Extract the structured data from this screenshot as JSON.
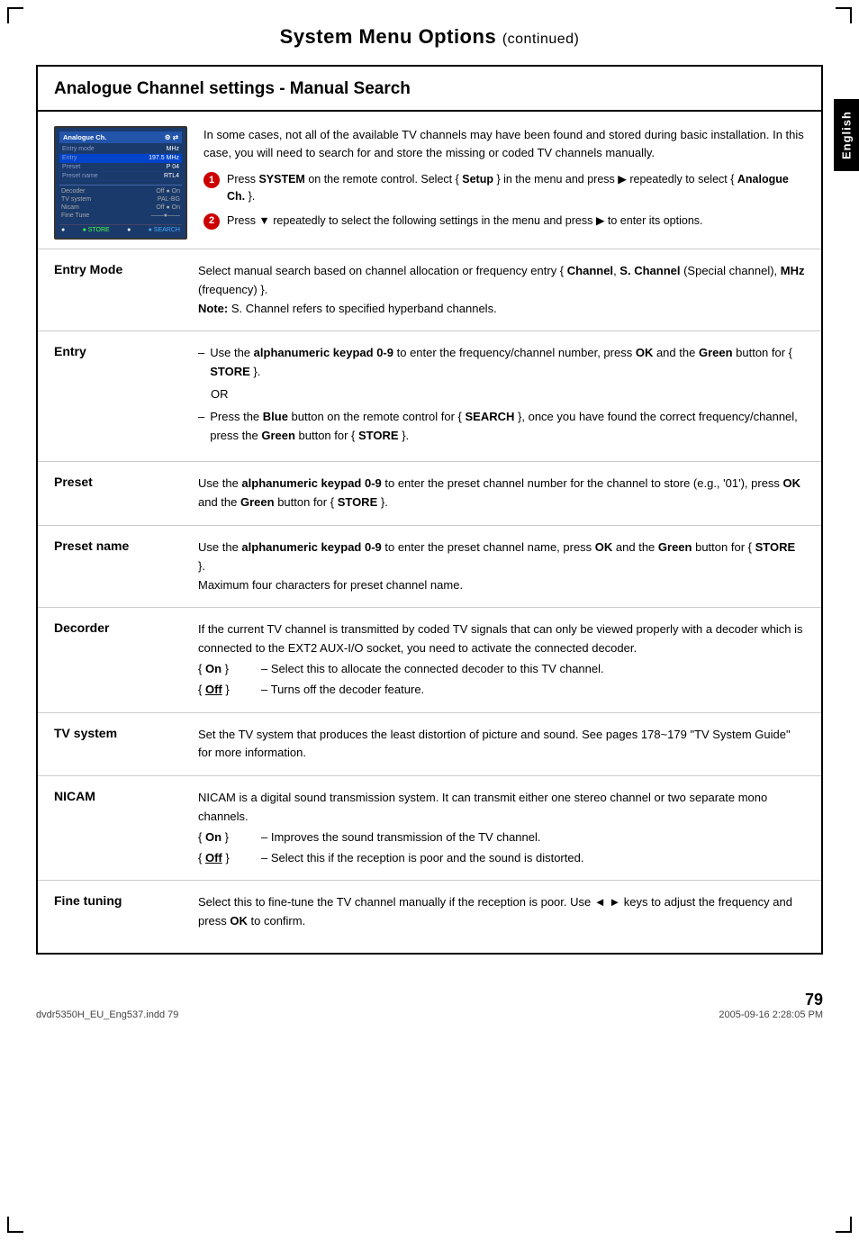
{
  "page": {
    "title": "System Menu Options",
    "title_suffix": "(continued)",
    "page_number": "79",
    "footer_filename": "dvdr5350H_EU_Eng537.indd  79",
    "footer_date": "2005-09-16  2:28:05 PM"
  },
  "english_tab": "English",
  "section": {
    "heading": "Analogue Channel settings - Manual Search"
  },
  "tv_mockup": {
    "title": "Analogue Ch.",
    "setup_label": "Setup",
    "rows": [
      {
        "label": "Entry mode",
        "value": "MHz"
      },
      {
        "label": "Entry",
        "value": "197.5 MHz"
      },
      {
        "label": "Preset",
        "value": "P 04"
      },
      {
        "label": "Preset name",
        "value": "RTL4"
      }
    ],
    "section2_rows": [
      {
        "label": "Decoder",
        "value": "Off  On"
      },
      {
        "label": "TV system",
        "value": "PAL-BG"
      },
      {
        "label": "Nicam",
        "value": "Off  On"
      },
      {
        "label": "Fine Tune",
        "value": ""
      }
    ],
    "store_label": "STORE",
    "search_label": "SEARCH"
  },
  "intro": {
    "paragraph": "In some cases, not all of the available TV channels may have been found and stored during basic installation. In this case, you will need to search for and store the missing or coded TV channels manually.",
    "step1": "Press SYSTEM on the remote control. Select { Setup } in the menu and press ▶ repeatedly to select { Analogue Ch. }.",
    "step2": "Press ▼ repeatedly to select the following settings in the menu and press ▶ to enter its options."
  },
  "rows": [
    {
      "label": "Entry Mode",
      "desc_parts": [
        {
          "type": "text",
          "text": "Select manual search based on channel allocation or frequency entry { "
        },
        {
          "type": "bold",
          "text": "Channel"
        },
        {
          "type": "text",
          "text": ", "
        },
        {
          "type": "bold",
          "text": "S. Channel"
        },
        {
          "type": "text",
          "text": " (Special channel), "
        },
        {
          "type": "bold",
          "text": "MHz"
        },
        {
          "type": "text",
          "text": " (frequency) }."
        }
      ],
      "note": "Note: S. Channel refers to specified hyperband channels.",
      "dash_items": []
    },
    {
      "label": "Entry",
      "dash_items": [
        {
          "text_parts": [
            {
              "type": "text",
              "text": "Use the "
            },
            {
              "type": "bold",
              "text": "alphanumeric keypad 0-9"
            },
            {
              "type": "text",
              "text": " to enter the frequency/channel number, press "
            },
            {
              "type": "bold",
              "text": "OK"
            },
            {
              "type": "text",
              "text": " and the "
            },
            {
              "type": "bold",
              "text": "Green"
            },
            {
              "type": "text",
              "text": " button for { "
            },
            {
              "type": "bold",
              "text": "STORE"
            },
            {
              "type": "text",
              "text": " }."
            }
          ]
        },
        {
          "or": true,
          "text": "OR"
        },
        {
          "text_parts": [
            {
              "type": "text",
              "text": "Press the "
            },
            {
              "type": "bold",
              "text": "Blue"
            },
            {
              "type": "text",
              "text": " button on the remote control for { "
            },
            {
              "type": "bold",
              "text": "SEARCH"
            },
            {
              "type": "text",
              "text": " }, once you have found the correct frequency/channel, press the "
            },
            {
              "type": "bold",
              "text": "Green"
            },
            {
              "type": "text",
              "text": " button for { "
            },
            {
              "type": "bold",
              "text": "STORE"
            },
            {
              "type": "text",
              "text": " }."
            }
          ]
        }
      ]
    },
    {
      "label": "Preset",
      "desc_parts": [
        {
          "type": "text",
          "text": "Use the "
        },
        {
          "type": "bold",
          "text": "alphanumeric keypad 0-9"
        },
        {
          "type": "text",
          "text": " to enter the preset channel number for the channel to store (e.g., '01'), press "
        },
        {
          "type": "bold",
          "text": "OK"
        },
        {
          "type": "text",
          "text": " and the "
        },
        {
          "type": "bold",
          "text": "Green"
        },
        {
          "type": "text",
          "text": " button for { "
        },
        {
          "type": "bold",
          "text": "STORE"
        },
        {
          "type": "text",
          "text": " }."
        }
      ]
    },
    {
      "label": "Preset name",
      "desc_parts": [
        {
          "type": "text",
          "text": "Use the "
        },
        {
          "type": "bold",
          "text": "alphanumeric keypad 0-9"
        },
        {
          "type": "text",
          "text": " to enter the preset channel name, press "
        },
        {
          "type": "bold",
          "text": "OK"
        },
        {
          "type": "text",
          "text": " and the "
        },
        {
          "type": "bold",
          "text": "Green"
        },
        {
          "type": "text",
          "text": " button for { "
        },
        {
          "type": "bold",
          "text": "STORE"
        },
        {
          "type": "text",
          "text": " }."
        }
      ],
      "extra": "Maximum four characters for preset channel name."
    },
    {
      "label": "Decorder",
      "intro": "If the current TV channel is transmitted by coded TV signals that can only be viewed properly with a decoder which is connected to the EXT2 AUX-I/O socket, you need to activate the connected decoder.",
      "options": [
        {
          "label": "{ On }",
          "desc": "– Select this to allocate the connected decoder to this TV channel."
        },
        {
          "label": "{ Off }",
          "underline_label": true,
          "desc": "– Turns off the decoder feature."
        }
      ]
    },
    {
      "label": "TV system",
      "desc_parts": [
        {
          "type": "text",
          "text": "Set the TV system that produces the least distortion of picture and sound. See pages 178~179 \"TV System Guide\" for more information."
        }
      ]
    },
    {
      "label": "NICAM",
      "intro": "NICAM is a digital sound transmission system. It can transmit either one stereo channel or two separate mono channels.",
      "options": [
        {
          "label": "{ On }",
          "desc": "– Improves the sound transmission of the TV channel."
        },
        {
          "label": "{ Off }",
          "underline_label": true,
          "desc": "– Select this if the reception is poor and the sound is distorted."
        }
      ]
    },
    {
      "label": "Fine tuning",
      "desc_parts": [
        {
          "type": "text",
          "text": "Select this to fine-tune the TV channel manually if the reception is poor. Use ◄ ► keys to adjust the frequency and press "
        },
        {
          "type": "bold",
          "text": "OK"
        },
        {
          "type": "text",
          "text": " to confirm."
        }
      ]
    }
  ]
}
